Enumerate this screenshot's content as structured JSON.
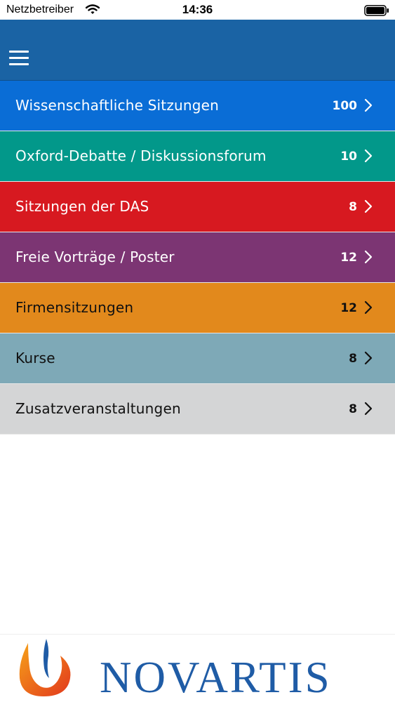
{
  "status_bar": {
    "carrier": "Netzbetreiber",
    "time": "14:36"
  },
  "nav": {
    "menu_icon": "hamburger-icon"
  },
  "sessions": [
    {
      "label": "Wissenschaftliche Sitzungen",
      "count": "100",
      "color": "#0a6dd6",
      "text_color": "#ffffff"
    },
    {
      "label": "Oxford-Debatte / Diskussionsforum",
      "count": "10",
      "color": "#02988a",
      "text_color": "#ffffff"
    },
    {
      "label": "Sitzungen der DAS",
      "count": "8",
      "color": "#d71920",
      "text_color": "#ffffff"
    },
    {
      "label": "Freie Vorträge / Poster",
      "count": "12",
      "color": "#7c3573",
      "text_color": "#ffffff"
    },
    {
      "label": "Firmensitzungen",
      "count": "12",
      "color": "#e2891c",
      "text_color": "#111111"
    },
    {
      "label": "Kurse",
      "count": "8",
      "color": "#7ea9b7",
      "text_color": "#111111"
    },
    {
      "label": "Zusatzveranstaltungen",
      "count": "8",
      "color": "#d4d5d6",
      "text_color": "#111111"
    }
  ],
  "footer": {
    "logo_text": "NOVARTIS"
  }
}
